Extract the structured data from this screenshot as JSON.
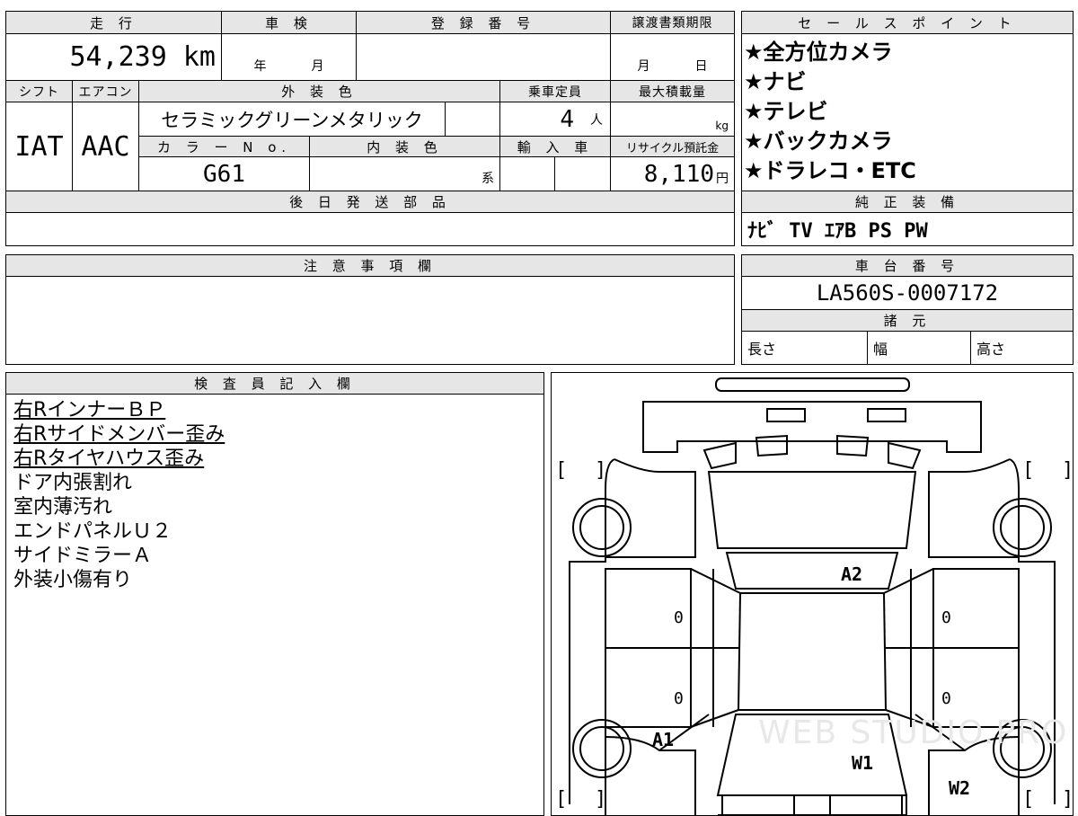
{
  "vehicle": {
    "mileage_label": "走 行",
    "mileage": "54,239 km",
    "inspection_label": "車 検",
    "inspection_year_unit": "年",
    "inspection_month_unit": "月",
    "registration_label": "登 録 番 号",
    "registration_value": "",
    "transfer_deadline_label": "譲渡書類期限",
    "transfer_month_unit": "月",
    "transfer_day_unit": "日",
    "shift_label": "シフト",
    "shift": "IAT",
    "aircon_label": "エアコン",
    "aircon": "AAC",
    "exterior_color_label": "外 装 色",
    "exterior_color": "セラミックグリーンメタリック",
    "capacity_label": "乗車定員",
    "capacity": "4",
    "capacity_unit": "人",
    "max_load_label": "最大積載量",
    "max_load_unit": "kg",
    "color_no_label": "カ ラ ー N o.",
    "color_no": "G61",
    "interior_color_label": "内 装 色",
    "interior_suffix": "系",
    "import_label": "輸 入 車",
    "recycle_label": "リサイクル預託金",
    "recycle_value": "8,110",
    "recycle_unit": "円",
    "later_parts_label": "後 日 発 送 部 品"
  },
  "sales_points": {
    "label": "セ ー ル ス ポ イ ン ト",
    "items": [
      "★全方位カメラ",
      "★ナビ",
      "★テレビ",
      "★バックカメラ",
      "★ドラレコ・ETC"
    ]
  },
  "genuine_equipment": {
    "label": "純 正 装 備",
    "value": "ﾅﾋﾞ TV ｴｱB PS PW"
  },
  "caution": {
    "label": "注 意 事 項 欄"
  },
  "chassis": {
    "label": "車 台 番 号",
    "value": "LA560S-0007172"
  },
  "specs": {
    "label": "諸 元",
    "length_label": "長さ",
    "width_label": "幅",
    "height_label": "高さ"
  },
  "inspector": {
    "label": "検 査 員 記 入 欄",
    "notes": [
      {
        "text": "右RインナーＢＰ",
        "underlined": true
      },
      {
        "text": "右Rサイドメンバー歪み",
        "underlined": true
      },
      {
        "text": "右Rタイヤハウス歪み",
        "underlined": true
      },
      {
        "text": "ドア内張割れ",
        "underlined": false
      },
      {
        "text": "室内薄汚れ",
        "underlined": false
      },
      {
        "text": "エンドパネルＵ２",
        "underlined": false
      },
      {
        "text": "サイドミラーＡ",
        "underlined": false
      },
      {
        "text": "外装小傷有り",
        "underlined": false
      }
    ]
  },
  "diagram": {
    "marks": {
      "a2": "A2",
      "a1": "A1",
      "w1": "W1",
      "w2": "W2",
      "door_l1": "0",
      "door_l2": "0",
      "door_r1": "0",
      "door_r2": "0"
    },
    "bracket_open": "[",
    "bracket_close": "]",
    "watermark": "WEB STUDIO.PRO"
  }
}
